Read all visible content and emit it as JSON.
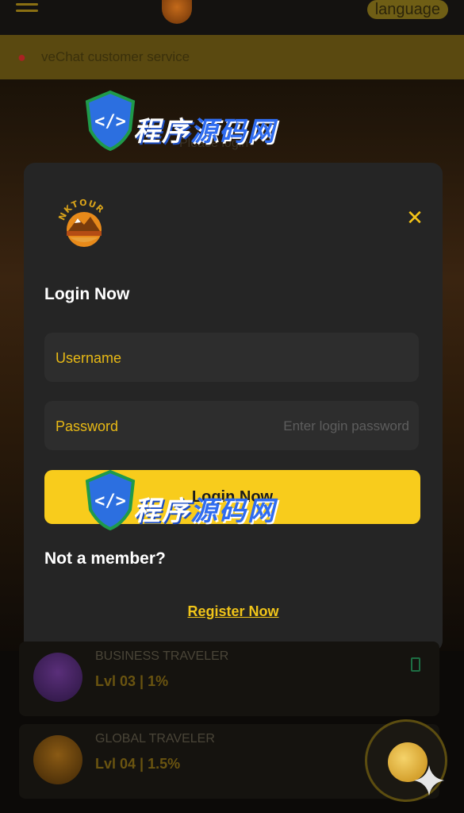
{
  "header": {
    "language_label": "language"
  },
  "notice": {
    "text": "veChat customer service"
  },
  "background": {
    "heading": "Please login"
  },
  "login_modal": {
    "brand": "NKTOUR",
    "close_glyph": "✕",
    "title": "Login Now",
    "username": {
      "label": "Username",
      "placeholder": ""
    },
    "password": {
      "label": "Password",
      "placeholder": "Enter login password"
    },
    "submit_label": "Login Now",
    "not_member_text": "Not a member?",
    "register_label": "Register Now"
  },
  "tiers": [
    {
      "name": "BUSINESS TRAVELER",
      "level": "Lvl 03 | 1%"
    },
    {
      "name": "GLOBAL TRAVELER",
      "level": "Lvl 04 | 1.5%"
    }
  ],
  "watermark": {
    "text_white": "程序",
    "text_blue": "源码网"
  },
  "icons": {
    "menu": "hamburger-menu-icon",
    "close": "close-icon",
    "notice": "bell-icon",
    "chat": "chat-bubble-icon",
    "sparkle": "sparkle-icon"
  },
  "colors": {
    "accent": "#f8cc1c",
    "label_gold": "#e8b915",
    "modal_bg": "#252525",
    "field_bg": "#2d2d2d"
  }
}
